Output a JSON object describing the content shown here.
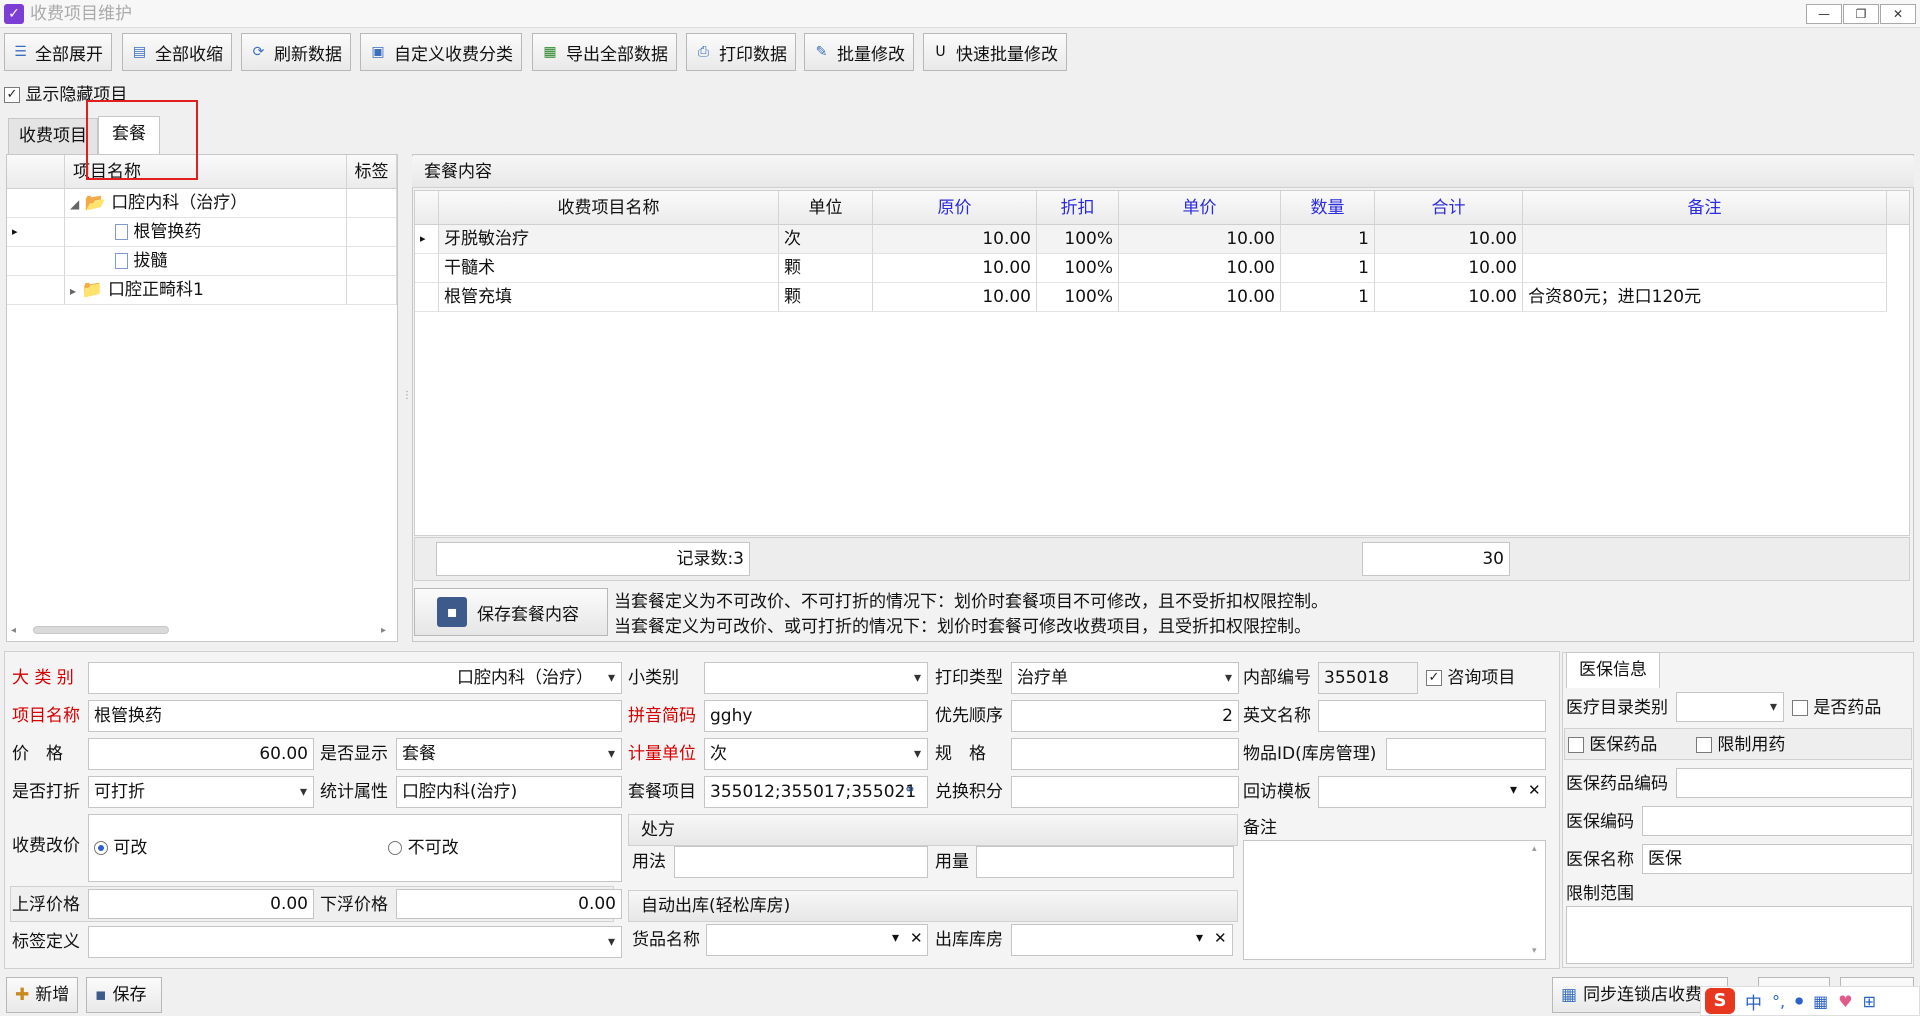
{
  "window": {
    "title": "收费项目维护"
  },
  "toolbar": [
    {
      "label": "全部展开",
      "icon": "list-expand-icon"
    },
    {
      "label": "全部收缩",
      "icon": "collapse-icon"
    },
    {
      "label": "刷新数据",
      "icon": "refresh-icon"
    },
    {
      "label": "自定义收费分类",
      "icon": "category-icon"
    },
    {
      "label": "导出全部数据",
      "icon": "excel-export-icon"
    },
    {
      "label": "打印数据",
      "icon": "printer-icon"
    },
    {
      "label": "批量修改",
      "icon": "batch-edit-icon"
    },
    {
      "label": "快速批量修改",
      "icon": "quick-edit-icon"
    }
  ],
  "show_hidden": {
    "label": "显示隐藏项目",
    "checked": true
  },
  "tabs": [
    "收费项目",
    "套餐"
  ],
  "tree": {
    "headers": [
      "项目名称",
      "标签"
    ],
    "nodes": [
      {
        "label": "口腔内科（治疗）",
        "level": 0,
        "expanded": true
      },
      {
        "label": "根管换药",
        "level": 1
      },
      {
        "label": "拔髓",
        "level": 1
      },
      {
        "label": "口腔正畸科1",
        "level": 0,
        "expanded": false
      }
    ]
  },
  "package": {
    "title": "套餐内容",
    "headers": [
      "收费项目名称",
      "单位",
      "原价",
      "折扣",
      "单价",
      "数量",
      "合计",
      "备注"
    ],
    "rows": [
      {
        "name": "牙脱敏治疗",
        "unit": "次",
        "orig": "10.00",
        "disc": "100%",
        "price": "10.00",
        "qty": "1",
        "total": "10.00",
        "note": ""
      },
      {
        "name": "干髓术",
        "unit": "颗",
        "orig": "10.00",
        "disc": "100%",
        "price": "10.00",
        "qty": "1",
        "total": "10.00",
        "note": ""
      },
      {
        "name": "根管充填",
        "unit": "颗",
        "orig": "10.00",
        "disc": "100%",
        "price": "10.00",
        "qty": "1",
        "total": "10.00",
        "note": "合资80元；进口120元"
      }
    ],
    "footer_count": "记录数:3",
    "footer_total": "30",
    "save_label": "保存套餐内容",
    "note1": "当套餐定义为不可改价、不可打折的情况下：划价时套餐项目不可修改，且不受折扣权限控制。",
    "note2": "当套餐定义为可改价、或可打折的情况下：划价时套餐可修改收费项目，且受折扣权限控制。"
  },
  "form": {
    "category_label": "大 类 别",
    "category_value": "口腔内科（治疗）",
    "subcategory_label": "小类别",
    "subcategory_value": "",
    "print_type_label": "打印类型",
    "print_type_value": "治疗单",
    "internal_code_label": "内部编号",
    "internal_code_value": "355018",
    "consult_label": "咨询项目",
    "name_label": "项目名称",
    "name_value": "根管换药",
    "pinyin_label": "拼音简码",
    "pinyin_value": "gghy",
    "priority_label": "优先顺序",
    "priority_value": "2",
    "english_label": "英文名称",
    "english_value": "",
    "price_label": "价　格",
    "price_value": "60.00",
    "display_label": "是否显示",
    "display_value": "套餐",
    "unit_label": "计量单位",
    "unit_value": "次",
    "spec_label": "规　格",
    "spec_value": "",
    "itemid_label": "物品ID(库房管理)",
    "itemid_value": "",
    "discount_label": "是否打折",
    "discount_value": "可打折",
    "stat_label": "统计属性",
    "stat_value": "口腔内科(治疗)",
    "pkgitems_label": "套餐项目",
    "pkgitems_value": "355012;355017;355021",
    "points_label": "兑换积分",
    "points_value": "",
    "revisit_label": "回访模板",
    "revisit_value": "",
    "change_price_label": "收费改价",
    "change_yes": "可改",
    "change_no": "不可改",
    "prescription_head": "处方",
    "usage_label": "用法",
    "usage_value": "",
    "dosage_label": "用量",
    "dosage_value": "",
    "remark_label": "备注",
    "up_label": "上浮价格",
    "up_value": "0.00",
    "down_label": "下浮价格",
    "down_value": "0.00",
    "autostock_head": "自动出库(轻松库房)",
    "goods_label": "货品名称",
    "goods_value": "",
    "warehouse_label": "出库库房",
    "warehouse_value": "",
    "tagdef_label": "标签定义",
    "tagdef_value": ""
  },
  "insurance": {
    "tab": "医保信息",
    "catalog_label": "医疗目录类别",
    "catalog_value": "",
    "is_drug_label": "是否药品",
    "ins_drug_label": "医保药品",
    "restricted_label": "限制用药",
    "drug_code_label": "医保药品编码",
    "drug_code_value": "",
    "code_label": "医保编码",
    "code_value": "",
    "name_label": "医保名称",
    "name_value": "医保",
    "scope_label": "限制范围"
  },
  "bottom": {
    "add_label": "新增",
    "save_label": "保存",
    "sync_label": "同步连锁店收费"
  },
  "ime": {
    "lang": "中"
  }
}
